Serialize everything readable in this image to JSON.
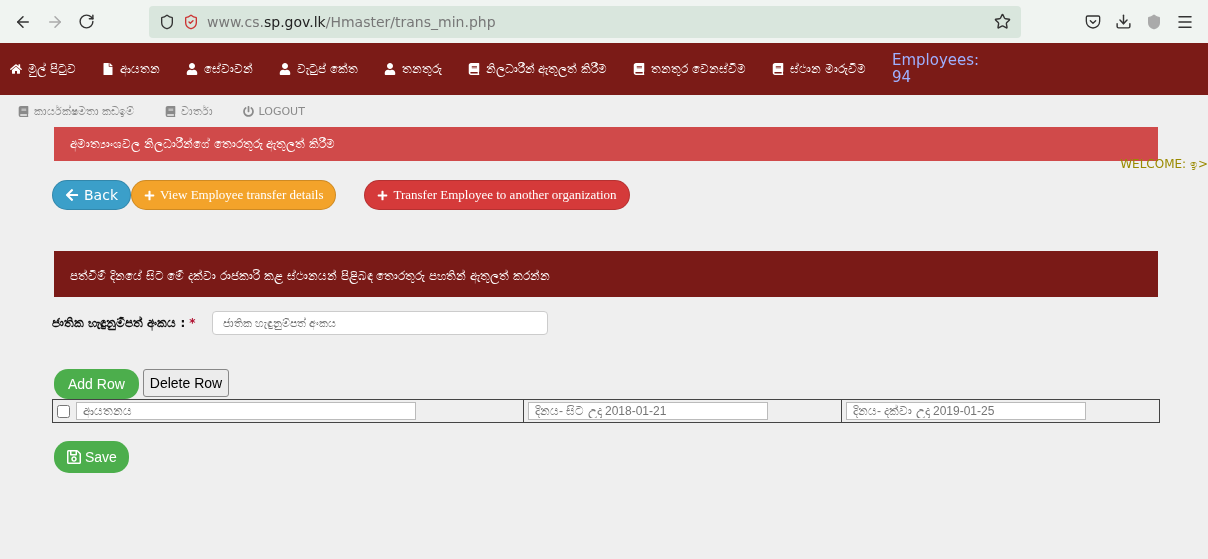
{
  "browser": {
    "url_host": "www.cs.",
    "url_domain": "sp.gov.lk",
    "url_path": "/Hmaster/trans_min.php"
  },
  "nav": {
    "items": [
      {
        "label": "මුල් පිටුව",
        "kind": "home"
      },
      {
        "label": "ආයතන",
        "kind": "file"
      },
      {
        "label": "සේවාවන්",
        "kind": "user"
      },
      {
        "label": "වැටුප් කේත",
        "kind": "user"
      },
      {
        "label": "තනතුරු",
        "kind": "user"
      },
      {
        "label": "නිලධාරීන් ඇතුලත් කිරීම",
        "kind": "book"
      },
      {
        "label": "තනතුර වෙනස්වීම",
        "kind": "book"
      },
      {
        "label": "ස්ථාන මාරුවීම",
        "kind": "book"
      }
    ],
    "employees": "Employees: 94",
    "faded_items": [
      {
        "label": "කාර්යක්ෂමතා කඩඉම්",
        "kind": "book"
      },
      {
        "label": "වාර්තා",
        "kind": "book"
      },
      {
        "label": "LOGOUT",
        "kind": "logout"
      }
    ]
  },
  "page_banner": "අමාත්‍යාංශවල නිලධාරීන්ගේ තොරතුරු ඇතුලත් කිරීම",
  "welcome": "WELCOME: ඉ>",
  "action_buttons": [
    {
      "label": "Back",
      "kind": "back"
    },
    {
      "label": "View Employee transfer details",
      "kind": "view"
    },
    {
      "label": "Transfer Employee to another organization",
      "kind": "transfer"
    }
  ],
  "section_banner": "පත්වීම් දිනයේ සිට මේ දක්වා රාජකාරි කළ ස්ථානයන් පිළිබඳ තොරතුරු පහතින් ඇතුලත් කරන්න",
  "nic": {
    "label": "ජාතික හැඳුනුම්පත් අංකය :",
    "required": "*",
    "placeholder": "ජාතික හැඳුනුම්පත් අංකය"
  },
  "row_buttons": [
    "Add Row",
    "Delete Row"
  ],
  "rows": [
    {
      "checked": false,
      "institution_placeholder": "ආයතනය",
      "from_placeholder": "දිනය- සිට උදා 2018-01-21",
      "to_placeholder": "දිනය- දක්වා උදා 2019-01-25"
    }
  ],
  "save": "Save"
}
